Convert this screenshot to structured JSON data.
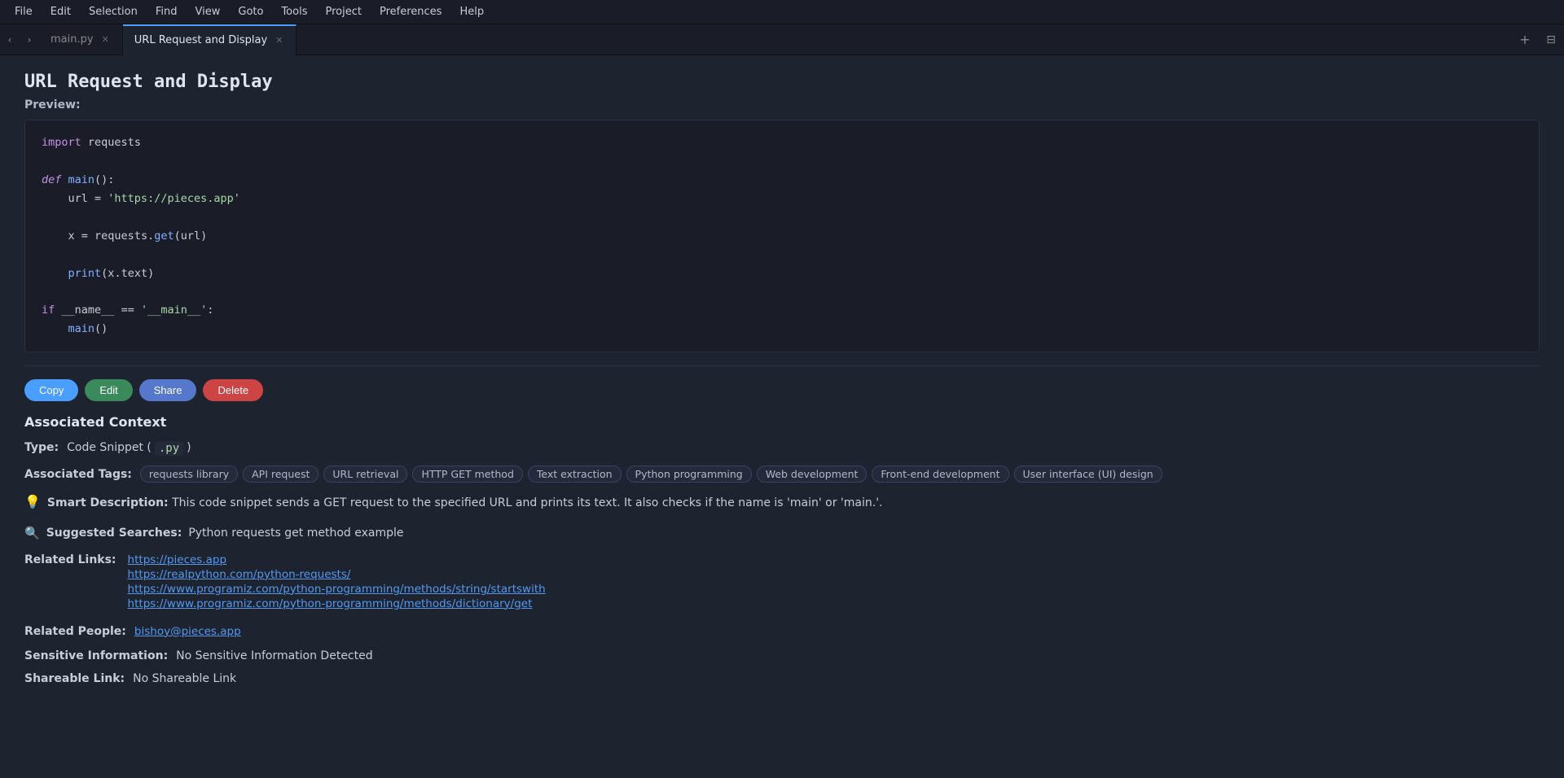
{
  "menubar": {
    "items": [
      "File",
      "Edit",
      "Selection",
      "Find",
      "View",
      "Goto",
      "Tools",
      "Project",
      "Preferences",
      "Help"
    ]
  },
  "tabs": {
    "nav_prev": "‹",
    "nav_next": "›",
    "items": [
      {
        "label": "main.py",
        "active": false
      },
      {
        "label": "URL Request and Display",
        "active": true
      }
    ],
    "new_btn": "+",
    "split_btn": "⊟"
  },
  "page": {
    "title": "URL Request and Display",
    "preview_label": "Preview:",
    "code_lines": [
      "import requests",
      "",
      "def main():",
      "    url = 'https://pieces.app'",
      "",
      "    x = requests.get(url)",
      "",
      "    print(x.text)",
      "",
      "if __name__ == '__main__':",
      "    main()"
    ]
  },
  "buttons": {
    "copy": "Copy",
    "edit": "Edit",
    "share": "Share",
    "delete": "Delete"
  },
  "associated_context": {
    "section_title": "Associated Context",
    "type_label": "Type:",
    "type_value": "Code Snippet ( ",
    "type_ext": ".py",
    "type_close": " )",
    "tags_label": "Associated Tags:",
    "tags": [
      "requests library",
      "API request",
      "URL retrieval",
      "HTTP GET method",
      "Text extraction",
      "Python programming",
      "Web development",
      "Front-end development",
      "User interface (UI) design"
    ],
    "smart_desc_icon": "💡",
    "smart_desc_label": "Smart Description:",
    "smart_desc_text": "This code snippet sends a GET request to the specified URL and prints its text. It also checks if the name is 'main' or 'main.'.",
    "suggested_icon": "🔍",
    "suggested_label": "Suggested Searches:",
    "suggested_text": "Python requests get method example",
    "related_links_label": "Related Links:",
    "links": [
      "https://pieces.app",
      "https://realpython.com/python-requests/",
      "https://www.programiz.com/python-programming/methods/string/startswith",
      "https://www.programiz.com/python-programming/methods/dictionary/get"
    ],
    "related_people_label": "Related People:",
    "related_people_value": "bishoy@pieces.app",
    "sensitive_label": "Sensitive Information:",
    "sensitive_value": "No Sensitive Information Detected",
    "shareable_label": "Shareable Link:",
    "shareable_value": "No Shareable Link"
  }
}
